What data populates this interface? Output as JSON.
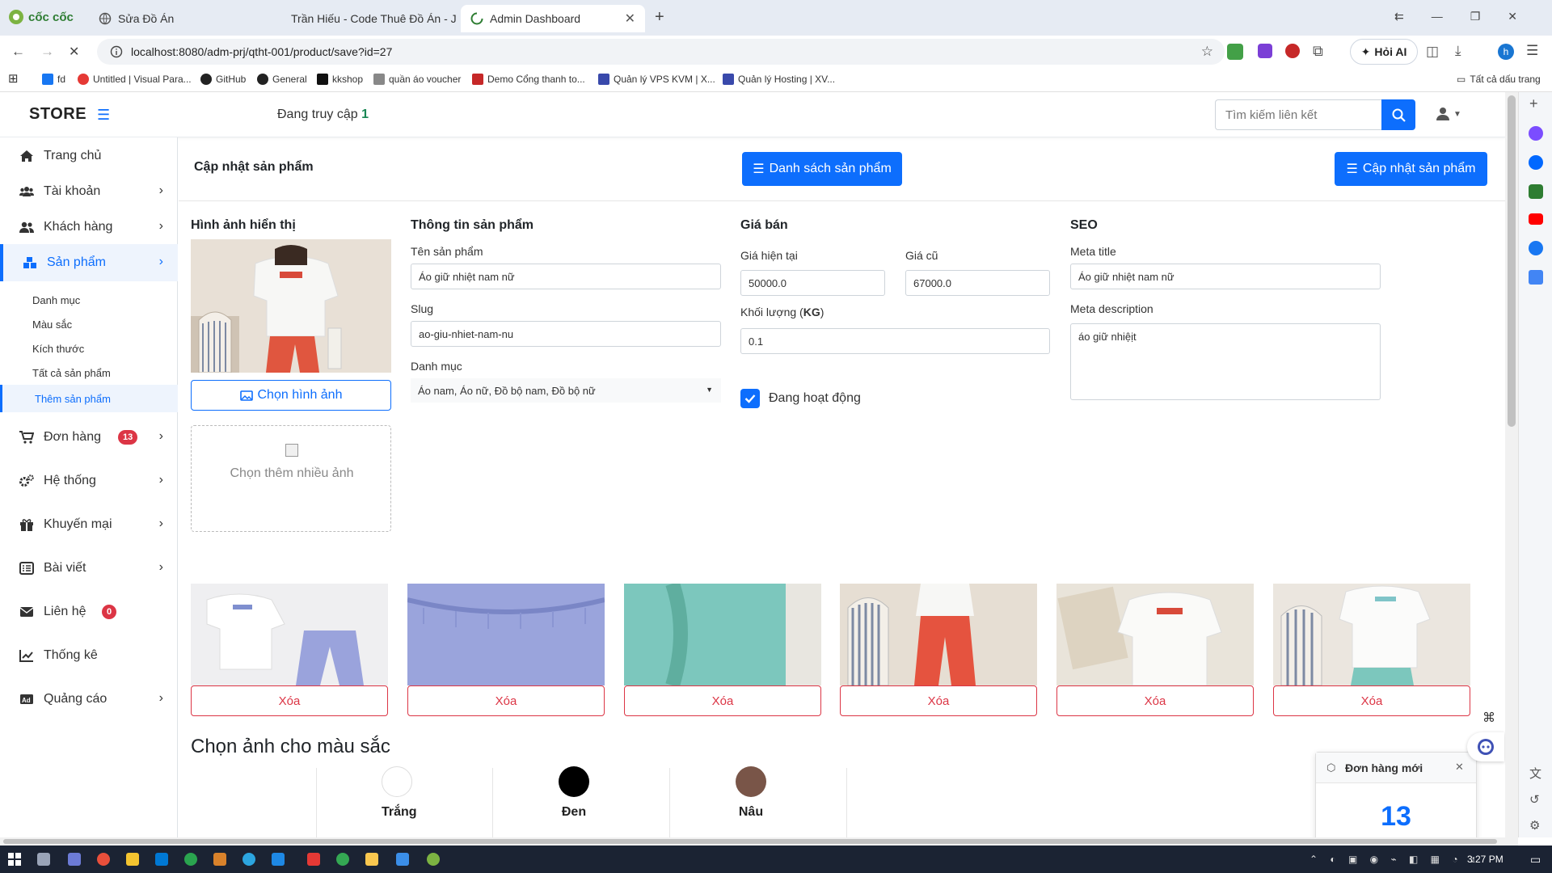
{
  "browser": {
    "tabs": [
      {
        "title": "Sửa Đồ Án",
        "active": false
      },
      {
        "title": "Trần Hiếu - Code Thuê Đồ Án - J",
        "active": false
      },
      {
        "title": "Admin Dashboard",
        "active": true
      }
    ],
    "logo_text": "cốc cốc",
    "url": "localhost:8080/adm-prj/qtht-001/product/save?id=27",
    "ai_button": "Hỏi AI",
    "profile_initial": "h",
    "bookmarks": [
      "fd",
      "Untitled | Visual Para...",
      "GitHub",
      "General",
      "kkshop",
      "quần áo voucher",
      "Demo Cổng thanh to...",
      "Quản lý VPS KVM | X...",
      "Quản lý Hosting | XV..."
    ],
    "all_bookmarks": "Tất cả dấu trang"
  },
  "topnav": {
    "brand": "STORE",
    "visitors_label": "Đang truy cập",
    "visitors_count": "1",
    "search_placeholder": "Tìm kiếm liên kết"
  },
  "sidebar": {
    "items": [
      {
        "label": "Trang chủ",
        "icon": "home-icon"
      },
      {
        "label": "Tài khoản",
        "icon": "users-icon"
      },
      {
        "label": "Khách hàng",
        "icon": "customers-icon"
      },
      {
        "label": "Sản phẩm",
        "icon": "boxes-icon"
      },
      {
        "label": "Đơn hàng",
        "icon": "cart-icon",
        "badge": "13"
      },
      {
        "label": "Hệ thống",
        "icon": "gears-icon"
      },
      {
        "label": "Khuyến mại",
        "icon": "gift-icon"
      },
      {
        "label": "Bài viết",
        "icon": "list-icon"
      },
      {
        "label": "Liên hệ",
        "icon": "envelope-icon",
        "badge": "0"
      },
      {
        "label": "Thống kê",
        "icon": "chart-icon"
      },
      {
        "label": "Quảng cáo",
        "icon": "ad-icon"
      }
    ],
    "subitems": [
      "Danh mục",
      "Màu sắc",
      "Kích thước",
      "Tất cả sản phẩm",
      "Thêm sản phẩm"
    ]
  },
  "page": {
    "title": "Cập nhật sản phẩm",
    "list_button": "Danh sách sản phẩm",
    "update_button": "Cập nhật sản phẩm"
  },
  "form": {
    "image_heading": "Hình ảnh hiển thị",
    "choose_image": "Chọn hình ảnh",
    "choose_more": "Chọn thêm nhiều ảnh",
    "info_heading": "Thông tin sản phẩm",
    "name_label": "Tên sản phẩm",
    "name_value": "Áo giữ nhiệt nam nữ",
    "slug_label": "Slug",
    "slug_value": "ao-giu-nhiet-nam-nu",
    "category_label": "Danh mục",
    "category_value": "Áo nam, Áo nữ, Đồ bộ nam, Đồ bộ nữ",
    "price_heading": "Giá bán",
    "current_price_label": "Giá hiện tại",
    "current_price": "50000.0",
    "old_price_label": "Giá cũ",
    "old_price": "67000.0",
    "weight_label": "Khối lượng",
    "weight_unit": "KG",
    "weight_value": "0.1",
    "active_label": "Đang hoạt động",
    "active_checked": true,
    "seo_heading": "SEO",
    "meta_title_label": "Meta title",
    "meta_title": "Áo giữ nhiệt nam nữ",
    "meta_desc_label": "Meta description",
    "meta_desc": "áo giữ nhiệịt"
  },
  "gallery": {
    "delete_label": "Xóa",
    "count": 6
  },
  "colors": {
    "heading": "Chọn ảnh cho màu sắc",
    "items": [
      {
        "name": "Trắng",
        "hex": "#ffffff"
      },
      {
        "name": "Đen",
        "hex": "#000000"
      },
      {
        "name": "Nâu",
        "hex": "#795548"
      }
    ]
  },
  "toast": {
    "title": "Đơn hàng mới",
    "count": "13"
  },
  "taskbar": {
    "time": "3:27 PM"
  },
  "theme": {
    "primary": "#0d6efd",
    "danger": "#dc3545"
  }
}
